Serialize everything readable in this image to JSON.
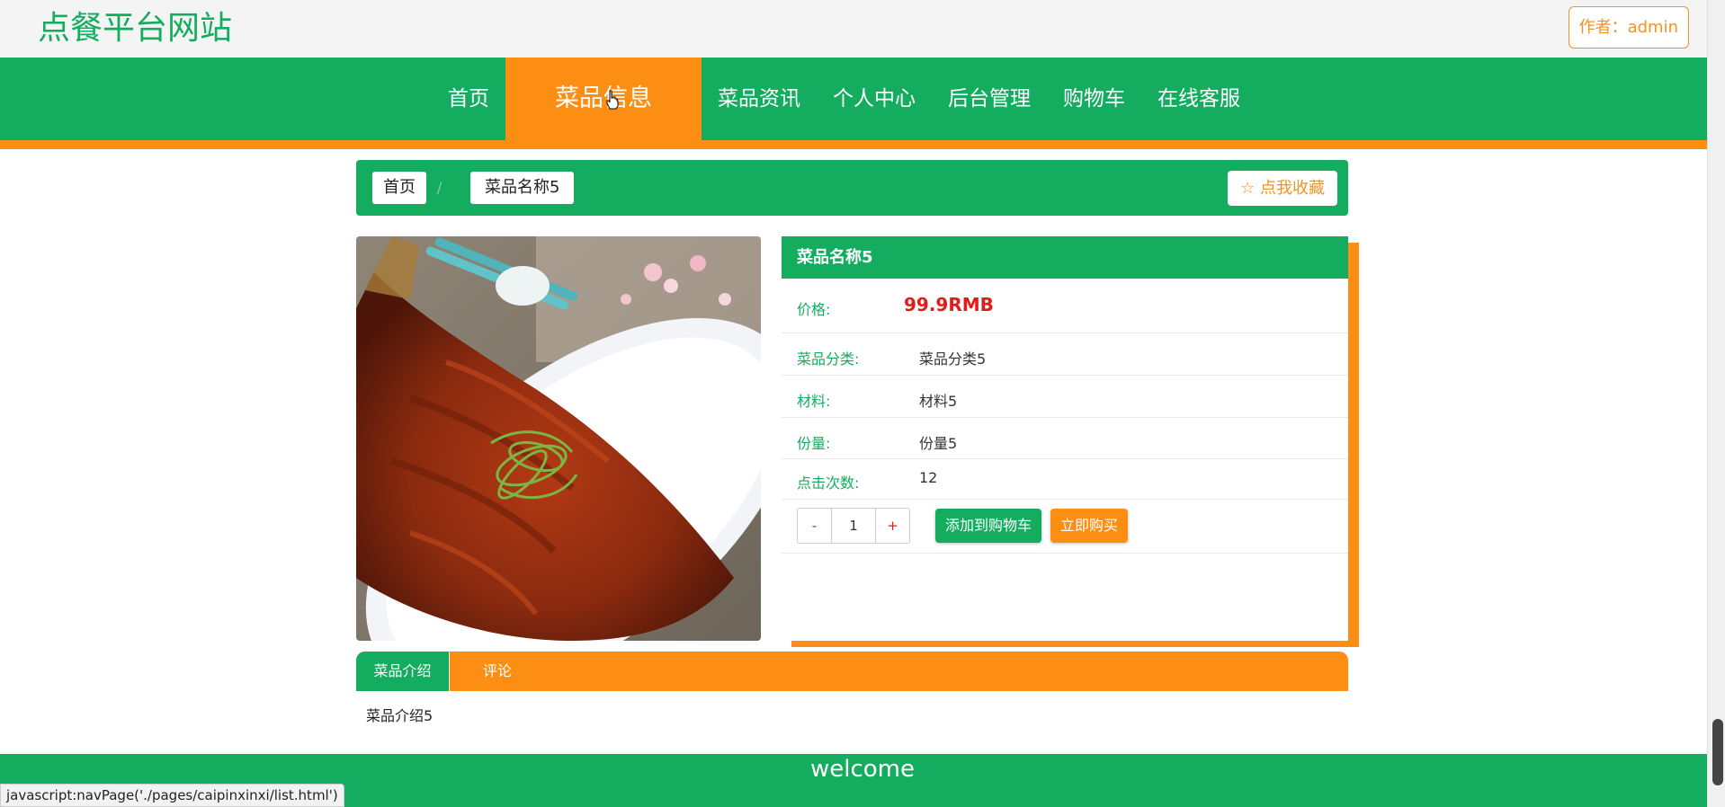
{
  "header": {
    "site_title": "点餐平台网站",
    "author_button": "作者：admin"
  },
  "nav": {
    "items": [
      {
        "label": "首页"
      },
      {
        "label": "菜品信息"
      },
      {
        "label": "菜品资讯"
      },
      {
        "label": "个人中心"
      },
      {
        "label": "后台管理"
      },
      {
        "label": "购物车"
      },
      {
        "label": "在线客服"
      }
    ],
    "active_index": 1
  },
  "breadcrumb": {
    "home": "首页",
    "separator": "/",
    "current": "菜品名称5",
    "favorite_button": "☆ 点我收藏"
  },
  "product": {
    "name": "菜品名称5",
    "price_label": "价格:",
    "price_value": "99.9RMB",
    "category_label": "菜品分类:",
    "category_value": "菜品分类5",
    "material_label": "材料:",
    "material_value": "材料5",
    "portion_label": "份量:",
    "portion_value": "份量5",
    "clicks_label": "点击次数:",
    "clicks_value": "12",
    "quantity": {
      "minus": "-",
      "value": "1",
      "plus": "+"
    },
    "add_to_cart": "添加到购物车",
    "buy_now": "立即购买"
  },
  "tabs": {
    "items": [
      {
        "label": "菜品介绍"
      },
      {
        "label": "评论"
      }
    ],
    "intro_content": "菜品介绍5"
  },
  "footer": {
    "text": "welcome"
  },
  "status_bar": {
    "text": "javascript:navPage('./pages/caipinxinxi/list.html')"
  },
  "colors": {
    "primary_green": "#14ad5f",
    "accent_orange": "#fc8e13",
    "price_red": "#e31b1b"
  }
}
